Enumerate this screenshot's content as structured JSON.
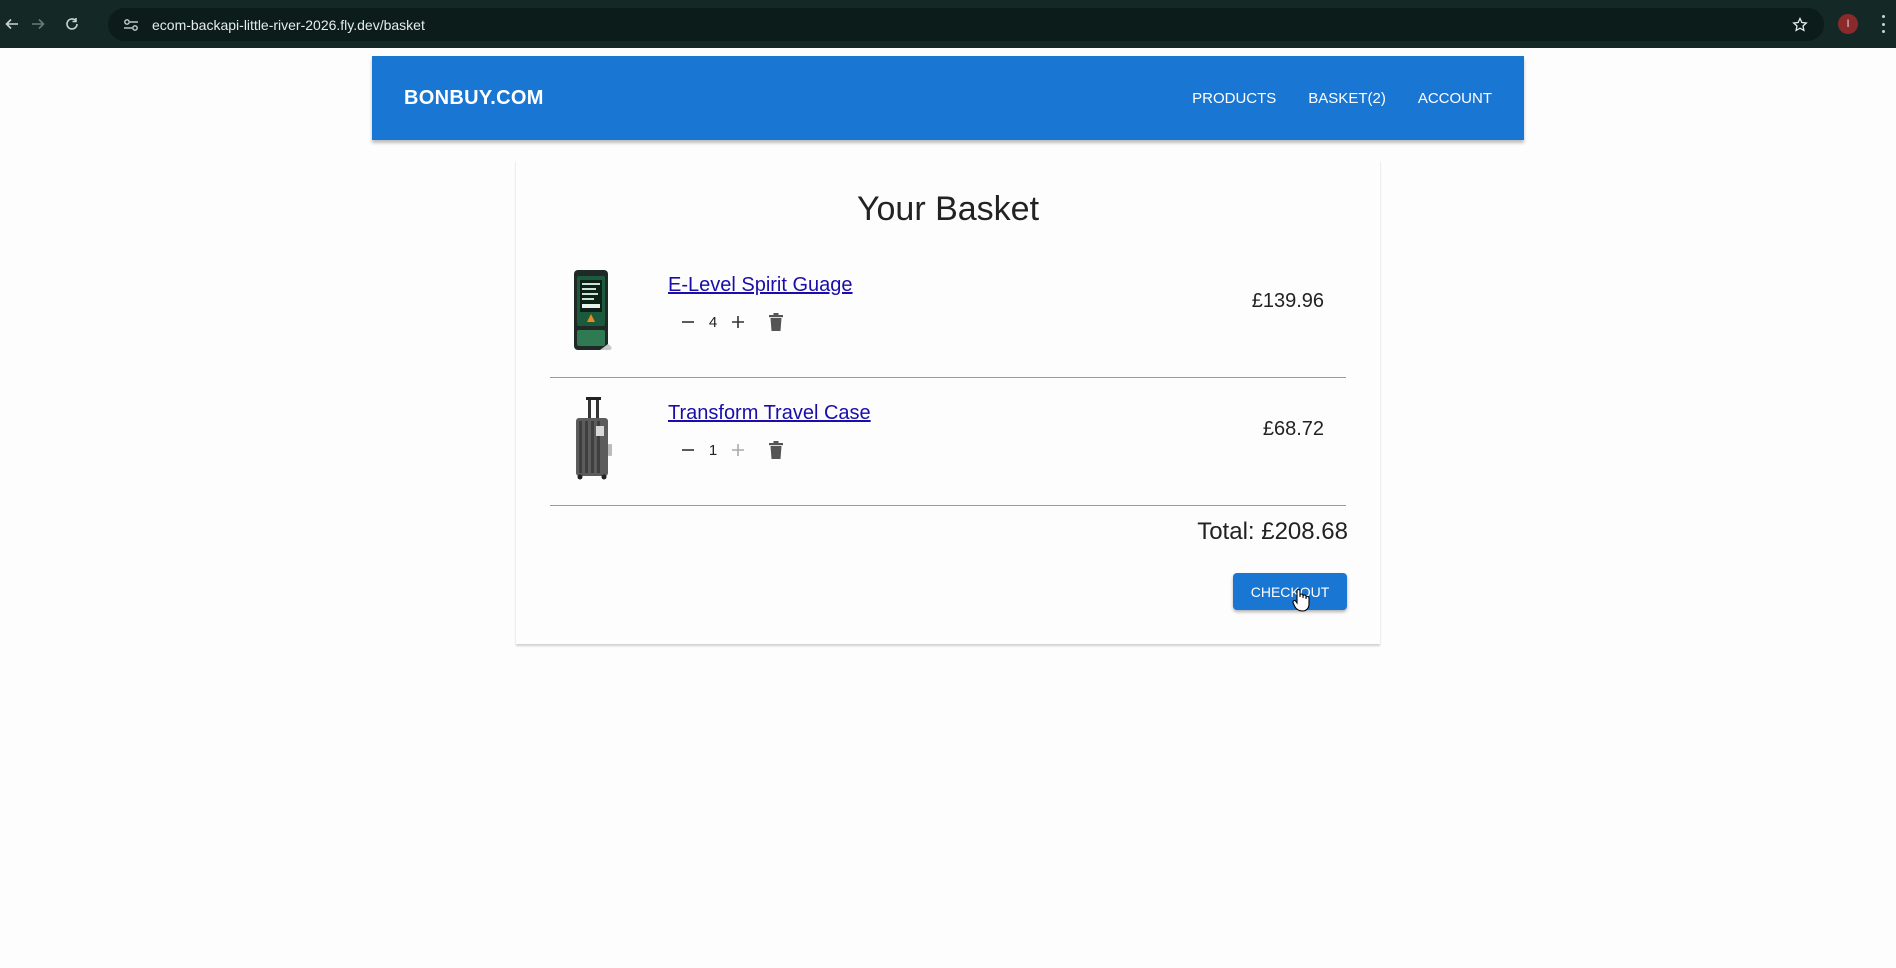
{
  "browser": {
    "url": "ecom-backapi-little-river-2026.fly.dev/basket",
    "profile_initial": "I",
    "icons": [
      "back-icon",
      "forward-icon",
      "reload-icon",
      "site-info-icon",
      "star-icon",
      "menu-icon"
    ]
  },
  "header": {
    "brand": "BONBUY.COM",
    "nav": {
      "products": "PRODUCTS",
      "basket": "BASKET(2)",
      "account": "ACCOUNT"
    },
    "bg_color": "#1976d2"
  },
  "basket": {
    "title": "Your Basket",
    "items": [
      {
        "name": "E-Level Spirit Guage",
        "quantity": "4",
        "price": "£139.96"
      },
      {
        "name": "Transform Travel Case",
        "quantity": "1",
        "price": "£68.72"
      }
    ],
    "total": "Total: £208.68",
    "checkout_label": "CHECKOUT"
  }
}
